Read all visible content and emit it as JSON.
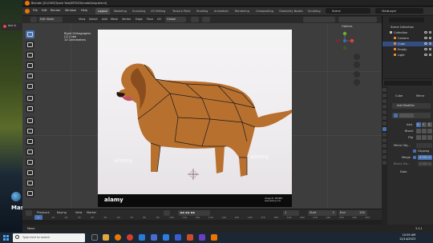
{
  "window": {
    "title": "Blender [D:\\CMS\\Tyane Yow\\IMT003\\model\\dog.blend]"
  },
  "desktop": {
    "tab_label": "Ace A",
    "bottom_text": "Mas"
  },
  "menu": [
    "File",
    "Edit",
    "Render",
    "Window",
    "Help"
  ],
  "workspaces": [
    "Layout",
    "Modeling",
    "Sculpting",
    "UV Editing",
    "Texture Paint",
    "Shading",
    "Animation",
    "Rendering",
    "Compositing",
    "Geometry Nodes",
    "Scripting"
  ],
  "active_workspace": "Layout",
  "scene": {
    "name": "Scene",
    "view_layer": "ViewLayer"
  },
  "viewport_header": {
    "mode": "Edit Mode",
    "menus": [
      "View",
      "Select",
      "Add",
      "Mesh",
      "Vertex",
      "Edge",
      "Face",
      "UV"
    ],
    "orientation": "Global",
    "options": "Options"
  },
  "viewport_info": {
    "line1": "Right Orthographic",
    "line2": "(1) Cube",
    "line3": "10 Centimeters"
  },
  "image": {
    "watermark": "alamy",
    "brand": "alamy",
    "footer_line1": "Image ID: PR4PNY",
    "footer_line2": "www.alamy.com"
  },
  "timeline": {
    "menus": [
      "Playback",
      "Keying",
      "View",
      "Marker"
    ],
    "current_frame": "1",
    "start_label": "Start",
    "start_value": "1",
    "end_label": "End",
    "end_value": "250",
    "ticks": [
      "0",
      "10",
      "20",
      "30",
      "40",
      "50",
      "60",
      "70",
      "80",
      "90",
      "100",
      "110",
      "120",
      "130",
      "140",
      "150",
      "160",
      "170",
      "180",
      "190",
      "200",
      "210",
      "220",
      "230",
      "240",
      "250"
    ]
  },
  "statusbar": {
    "item1": "Move",
    "item2": "3.4.1"
  },
  "outliner": {
    "root": "Scene Collection",
    "items": [
      {
        "label": "Collection",
        "indent": 1,
        "selected": false
      },
      {
        "label": "Camera",
        "indent": 2,
        "selected": false
      },
      {
        "label": "Cube",
        "indent": 2,
        "selected": true
      },
      {
        "label": "Empty",
        "indent": 2,
        "selected": false
      },
      {
        "label": "Light",
        "indent": 2,
        "selected": false
      }
    ]
  },
  "properties": {
    "object": "Cube",
    "modifier_name": "Mirror",
    "add_modifier": "Add Modifier",
    "axis_label": "Axis",
    "bisect_label": "Bisect",
    "flip_label": "Flip",
    "axes": [
      "X",
      "Y",
      "Z"
    ],
    "mirror_obj_label": "Mirror Obj...",
    "clipping_label": "Clipping",
    "merge_label": "Merge",
    "merge_value": "0.001 m",
    "bisect_dist_label": "Bisect Dis...",
    "bisect_dist_value": "0.001 m",
    "data_label": "Data"
  },
  "taskbar": {
    "search_placeholder": "Type here to search",
    "time": "10:59 AM",
    "date": "12/14/2023"
  },
  "colors": {
    "accent": "#4772b3",
    "selected": "#334d80",
    "brand_orange": "#ea7600"
  }
}
